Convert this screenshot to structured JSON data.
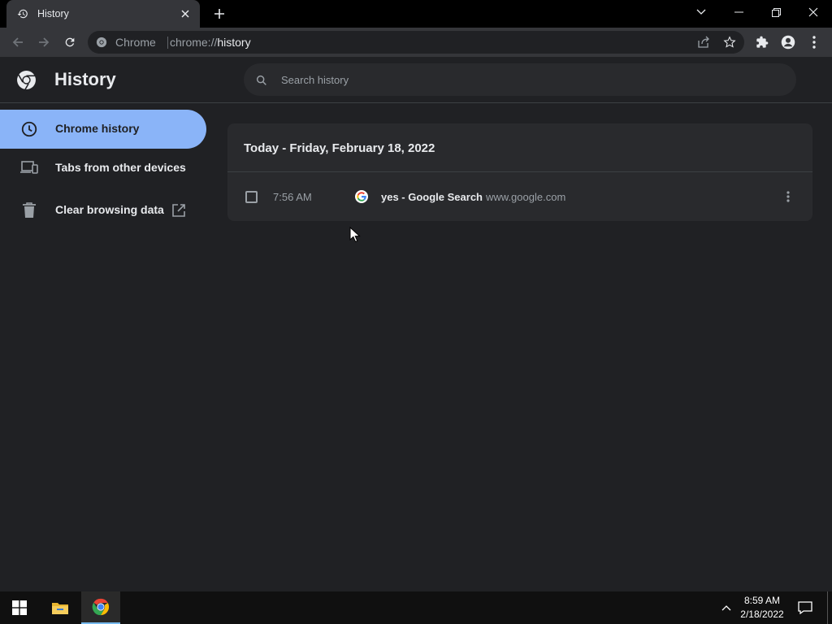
{
  "tab": {
    "title": "History",
    "icon": "history-icon",
    "close_icon": "close-icon"
  },
  "window": {
    "new_tab_icon": "plus-icon",
    "tab_search_icon": "chevron-down-icon",
    "minimize_icon": "minimize-icon",
    "restore_icon": "restore-icon",
    "close_icon": "close-icon"
  },
  "toolbar": {
    "back_icon": "back-arrow-icon",
    "forward_icon": "forward-arrow-icon",
    "reload_icon": "reload-icon",
    "omnibox": {
      "site_chip": "Chrome",
      "url_scheme": "chrome://",
      "url_host": "history",
      "share_icon": "share-icon",
      "bookmark_icon": "star-icon"
    },
    "extensions_icon": "puzzle-icon",
    "profile_icon": "profile-icon",
    "menu_icon": "more-vert-icon"
  },
  "header": {
    "title": "History",
    "logo": "chrome-logo",
    "search_placeholder": "Search history"
  },
  "sidebar": {
    "items": [
      {
        "label": "Chrome history",
        "icon": "clock-icon",
        "active": true
      },
      {
        "label": "Tabs from other devices",
        "icon": "devices-icon",
        "active": false
      },
      {
        "label": "Clear browsing data",
        "icon": "trash-icon",
        "active": false,
        "external_icon": "open-in-new-icon"
      }
    ]
  },
  "history": {
    "groups": [
      {
        "date": "Today - Friday, February 18, 2022",
        "entries": [
          {
            "time": "7:56 AM",
            "title": "yes - Google Search",
            "domain": "www.google.com",
            "favicon": "google-g-icon"
          }
        ]
      }
    ]
  },
  "taskbar": {
    "start_icon": "windows-start-icon",
    "apps": [
      {
        "name": "File Explorer",
        "icon": "folder-icon",
        "active": false
      },
      {
        "name": "Google Chrome",
        "icon": "chrome-icon",
        "active": true
      }
    ],
    "tray_icon": "chevron-up-icon",
    "time": "8:59 AM",
    "date": "2/18/2022",
    "notification_icon": "action-center-icon"
  },
  "colors": {
    "accent": "#8ab4f8",
    "background": "#202124",
    "card": "#292a2d",
    "toolbar": "#35363a"
  }
}
